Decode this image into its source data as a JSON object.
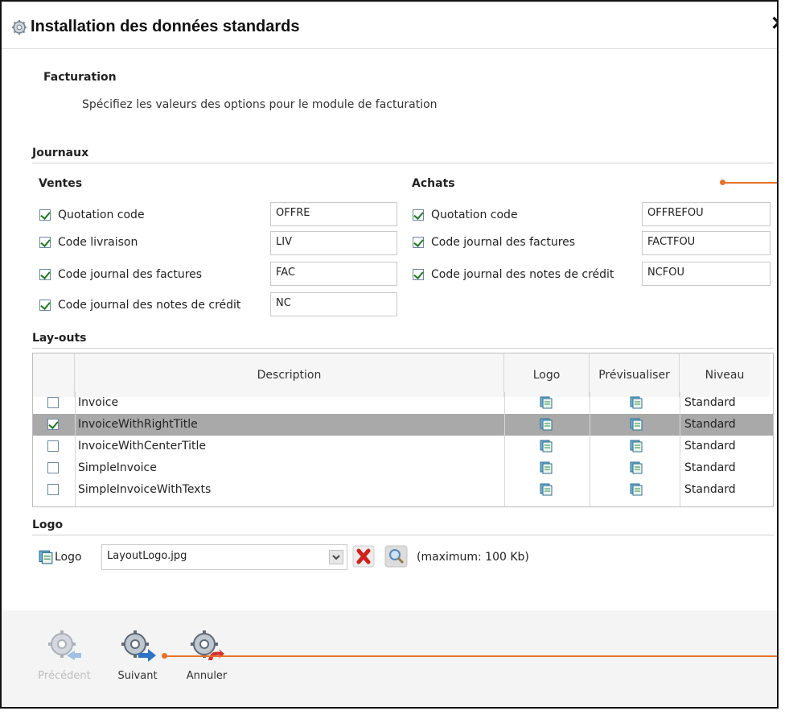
{
  "dialog": {
    "title": "Installation des données standards",
    "close_label": "✕"
  },
  "section": {
    "title": "Facturation",
    "description": "Spécifiez les valeurs des options pour le module de facturation"
  },
  "journaux": {
    "title": "Journaux",
    "ventes": {
      "title": "Ventes",
      "rows": [
        {
          "label": "Quotation code",
          "value": "OFFRE",
          "checked": true
        },
        {
          "label": "Code livraison",
          "value": "LIV",
          "checked": true
        },
        {
          "label": "Code journal des factures",
          "value": "FAC",
          "checked": true
        },
        {
          "label": "Code journal des notes de crédit",
          "value": "NC",
          "checked": true
        }
      ]
    },
    "achats": {
      "title": "Achats",
      "rows": [
        {
          "label": "Quotation code",
          "value": "OFFREFOU",
          "checked": true
        },
        {
          "label": "Code journal des factures",
          "value": "FACTFOU",
          "checked": true
        },
        {
          "label": "Code journal des notes de crédit",
          "value": "NCFOU",
          "checked": true
        }
      ]
    }
  },
  "layouts": {
    "title": "Lay-outs",
    "columns": [
      "Description",
      "Logo",
      "Prévisualiser",
      "Niveau"
    ],
    "rows": [
      {
        "description": "Invoice",
        "niveau": "Standard",
        "checked": false,
        "selected": false
      },
      {
        "description": "InvoiceWithRightTitle",
        "niveau": "Standard",
        "checked": true,
        "selected": true
      },
      {
        "description": "InvoiceWithCenterTitle",
        "niveau": "Standard",
        "checked": false,
        "selected": false
      },
      {
        "description": "SimpleInvoice",
        "niveau": "Standard",
        "checked": false,
        "selected": false
      },
      {
        "description": "SimpleInvoiceWithTexts",
        "niveau": "Standard",
        "checked": false,
        "selected": false
      }
    ]
  },
  "logo": {
    "title": "Logo",
    "label": "Logo",
    "value": "LayoutLogo.jpg",
    "hint": "(maximum: 100 Kb)"
  },
  "buttons": {
    "previous": "Précédent",
    "next": "Suivant",
    "cancel": "Annuler"
  },
  "icons": {
    "title": "gear-icon",
    "doc": "document-icon",
    "delete": "red-x-icon",
    "browse": "magnifier-icon"
  },
  "colors": {
    "selected_row": "#a9a9a9",
    "annotation": "#e8722a",
    "checkmark": "#1e7a1e"
  }
}
